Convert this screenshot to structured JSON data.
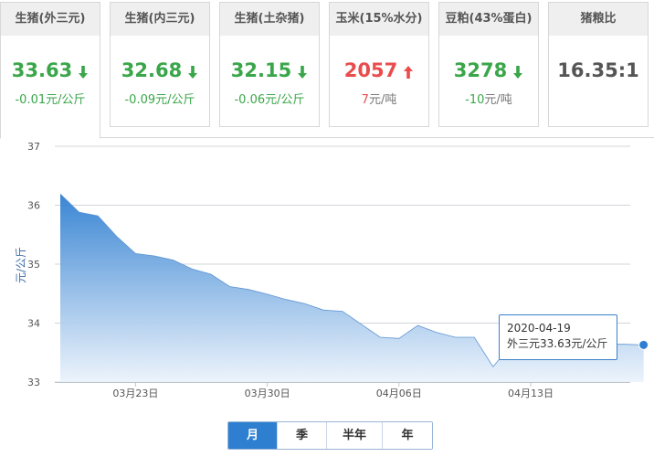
{
  "cards": [
    {
      "title": "生猪(外三元)",
      "value": "33.63",
      "direction": "down",
      "change": "-0.01元/公斤"
    },
    {
      "title": "生猪(内三元)",
      "value": "32.68",
      "direction": "down",
      "change": "-0.09元/公斤"
    },
    {
      "title": "生猪(土杂猪)",
      "value": "32.15",
      "direction": "down",
      "change": "-0.06元/公斤"
    },
    {
      "title": "玉米(15%水分)",
      "value": "2057",
      "direction": "up",
      "change_num": "7",
      "change_unit": "元/吨"
    },
    {
      "title": "豆粕(43%蛋白)",
      "value": "3278",
      "direction": "down",
      "change_num": "-10",
      "change_unit": "元/吨"
    },
    {
      "title": "猪粮比",
      "value": "16.35:1",
      "direction": "none",
      "change": ""
    }
  ],
  "periods": [
    "月",
    "季",
    "半年",
    "年"
  ],
  "active_period": "月",
  "tooltip": {
    "date": "2020-04-19",
    "text": "外三元33.63元/公斤"
  },
  "colors": {
    "up": "#ea4c4c",
    "down": "#3aa64a",
    "accent": "#2f7fd1",
    "fill_top": "#2f7fd1",
    "fill_bottom": "#eaf2fb"
  },
  "chart_data": {
    "type": "area",
    "ylabel": "元/公斤",
    "ylim": [
      33,
      37
    ],
    "yticks": [
      33,
      34,
      35,
      36,
      37
    ],
    "xticks": [
      {
        "date": "2020-03-23",
        "label": "03月23日"
      },
      {
        "date": "2020-03-30",
        "label": "03月30日"
      },
      {
        "date": "2020-04-06",
        "label": "04月06日"
      },
      {
        "date": "2020-04-13",
        "label": "04月13日"
      }
    ],
    "grid": true,
    "series": [
      {
        "points": [
          [
            "2020-03-19",
            36.19
          ],
          [
            "2020-03-20",
            35.88
          ],
          [
            "2020-03-21",
            35.82
          ],
          [
            "2020-03-22",
            35.47
          ],
          [
            "2020-03-23",
            35.18
          ],
          [
            "2020-03-24",
            35.14
          ],
          [
            "2020-03-25",
            35.07
          ],
          [
            "2020-03-26",
            34.92
          ],
          [
            "2020-03-27",
            34.83
          ],
          [
            "2020-03-28",
            34.62
          ],
          [
            "2020-03-29",
            34.57
          ],
          [
            "2020-03-30",
            34.49
          ],
          [
            "2020-03-31",
            34.4
          ],
          [
            "2020-04-01",
            34.33
          ],
          [
            "2020-04-02",
            34.22
          ],
          [
            "2020-04-03",
            34.2
          ],
          [
            "2020-04-04",
            33.98
          ],
          [
            "2020-04-05",
            33.76
          ],
          [
            "2020-04-06",
            33.74
          ],
          [
            "2020-04-07",
            33.96
          ],
          [
            "2020-04-08",
            33.84
          ],
          [
            "2020-04-09",
            33.76
          ],
          [
            "2020-04-10",
            33.76
          ],
          [
            "2020-04-11",
            33.26
          ],
          [
            "2020-04-12",
            33.64
          ],
          [
            "2020-04-13",
            33.64
          ],
          [
            "2020-04-14",
            33.64
          ],
          [
            "2020-04-15",
            33.64
          ],
          [
            "2020-04-16",
            33.64
          ],
          [
            "2020-04-17",
            33.64
          ],
          [
            "2020-04-18",
            33.64
          ],
          [
            "2020-04-19",
            33.63
          ]
        ]
      }
    ]
  }
}
